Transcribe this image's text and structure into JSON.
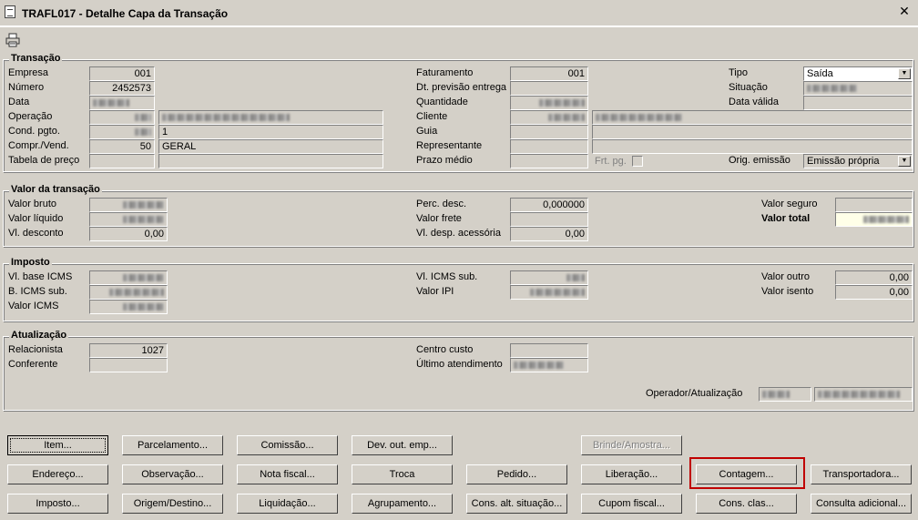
{
  "window": {
    "title": "TRAFL017 - Detalhe Capa da Transação",
    "close_glyph": "✕"
  },
  "toolbar": {
    "print_icon": "printer-icon"
  },
  "transacao": {
    "legend": "Transação",
    "empresa_label": "Empresa",
    "empresa": "001",
    "numero_label": "Número",
    "numero": "2452573",
    "data_label": "Data",
    "operacao_label": "Operação",
    "cond_pgto_label": "Cond. pgto.",
    "cond_pgto_desc": "1",
    "compr_vend_label": "Compr./Vend.",
    "compr_vend": "50",
    "compr_vend_desc": "GERAL",
    "tabela_preco_label": "Tabela de preço",
    "faturamento_label": "Faturamento",
    "faturamento": "001",
    "dt_prev_label": "Dt. previsão entrega",
    "quantidade_label": "Quantidade",
    "cliente_label": "Cliente",
    "guia_label": "Guia",
    "representante_label": "Representante",
    "prazo_medio_label": "Prazo médio",
    "frt_pg_label": "Frt. pg.",
    "tipo_label": "Tipo",
    "tipo": "Saída",
    "situacao_label": "Situação",
    "data_valida_label": "Data válida",
    "orig_emissao_label": "Orig. emissão",
    "orig_emissao": "Emissão própria"
  },
  "valor": {
    "legend": "Valor da transação",
    "valor_bruto_label": "Valor bruto",
    "valor_liquido_label": "Valor líquido",
    "vl_desconto_label": "Vl. desconto",
    "vl_desconto": "0,00",
    "perc_desc_label": "Perc. desc.",
    "perc_desc": "0,000000",
    "valor_frete_label": "Valor frete",
    "vl_desp_label": "Vl. desp. acessória",
    "vl_desp": "0,00",
    "valor_seguro_label": "Valor seguro",
    "valor_total_label": "Valor total"
  },
  "imposto": {
    "legend": "Imposto",
    "vl_base_icms_label": "Vl. base ICMS",
    "b_icms_sub_label": "B. ICMS sub.",
    "valor_icms_label": "Valor ICMS",
    "vl_icms_sub_label": "Vl. ICMS sub.",
    "valor_ipi_label": "Valor IPI",
    "valor_outro_label": "Valor outro",
    "valor_outro": "0,00",
    "valor_isento_label": "Valor isento",
    "valor_isento": "0,00"
  },
  "atualizacao": {
    "legend": "Atualização",
    "relacionista_label": "Relacionista",
    "relacionista": "1027",
    "conferente_label": "Conferente",
    "centro_custo_label": "Centro custo",
    "ultimo_atend_label": "Último atendimento",
    "operador_label": "Operador/Atualização"
  },
  "buttons": {
    "item": "Item...",
    "parcelamento": "Parcelamento...",
    "comissao": "Comissão...",
    "dev_out_emp": "Dev. out. emp...",
    "brinde": "Brinde/Amostra...",
    "endereco": "Endereço...",
    "observacao": "Observação...",
    "nota_fiscal": "Nota fiscal...",
    "troca": "Troca",
    "pedido": "Pedido...",
    "liberacao": "Liberação...",
    "contagem": "Contagem...",
    "transportadora": "Transportadora...",
    "imposto": "Imposto...",
    "origem_destino": "Origem/Destino...",
    "liquidacao": "Liquidação...",
    "agrupamento": "Agrupamento...",
    "cons_alt_situacao": "Cons. alt. situação...",
    "cupom_fiscal": "Cupom fiscal...",
    "cons_clas": "Cons. clas...",
    "consulta_adicional": "Consulta adicional..."
  },
  "colors": {
    "highlight": "#c00000",
    "background": "#d4d0c8"
  }
}
